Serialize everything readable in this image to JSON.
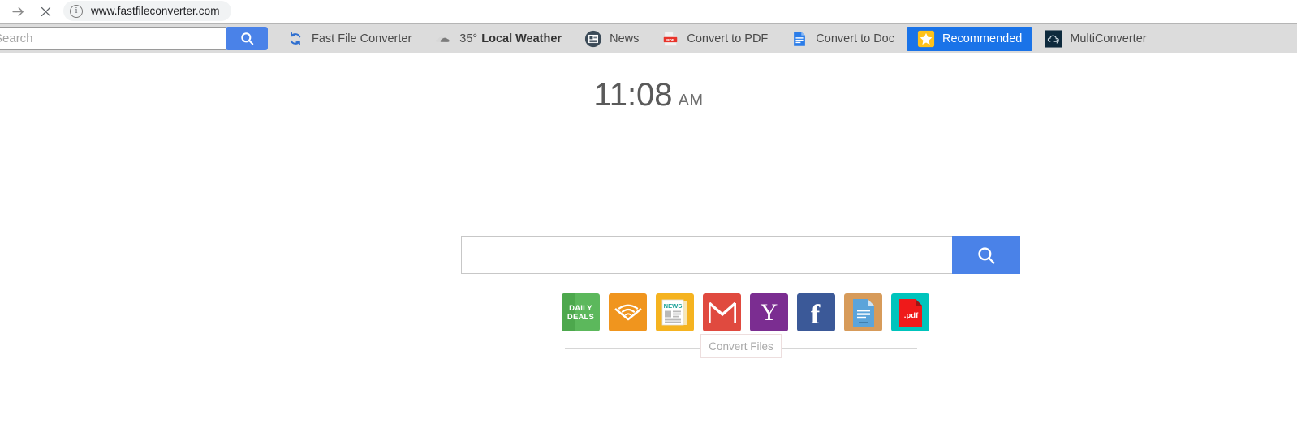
{
  "browser": {
    "forward_icon": "arrow-right-icon",
    "stop_icon": "close-icon",
    "info_icon": "info-icon",
    "info_glyph": "i",
    "url": "www.fastfileconverter.com"
  },
  "toolbar": {
    "search": {
      "placeholder": "Search",
      "value": "",
      "button_icon": "search-icon"
    },
    "items": [
      {
        "icon": "sync-refresh-icon",
        "label": "Fast File Converter",
        "highlight": false
      },
      {
        "icon": "cloud-weather-icon",
        "label": "Local Weather",
        "temp": "35°",
        "highlight": false
      },
      {
        "icon": "newspaper-icon",
        "label": "News",
        "highlight": false
      },
      {
        "icon": "pdf-file-icon",
        "label": "Convert to PDF",
        "highlight": false
      },
      {
        "icon": "doc-file-icon",
        "label": "Convert to Doc",
        "highlight": false
      },
      {
        "icon": "star-icon",
        "label": "Recommended",
        "highlight": true
      },
      {
        "icon": "cloud-upload-icon",
        "label": "MultiConverter",
        "highlight": false
      }
    ]
  },
  "page": {
    "clock": {
      "time": "11:08",
      "meridiem": "AM"
    },
    "search": {
      "placeholder": "",
      "value": "",
      "button_icon": "search-icon"
    },
    "shortcuts": [
      {
        "name": "daily-deals",
        "label": "DAILY\nDEALS",
        "color": "#5cb85c",
        "icon": "text-tile"
      },
      {
        "name": "audible",
        "label": "",
        "color": "#f0951e",
        "icon": "audible-icon"
      },
      {
        "name": "news",
        "label": "NEWS",
        "color": "#f5b320",
        "icon": "news-paper-icon"
      },
      {
        "name": "gmail",
        "label": "",
        "color": "#e04a3f",
        "icon": "envelope-icon"
      },
      {
        "name": "yahoo",
        "label": "Y",
        "color": "#7b2d91",
        "icon": "yahoo-icon"
      },
      {
        "name": "facebook",
        "label": "f",
        "color": "#3b5998",
        "icon": "facebook-icon"
      },
      {
        "name": "convert-to-doc",
        "label": "",
        "color": "#d79b5a",
        "icon": "doc-page-icon"
      },
      {
        "name": "convert-to-pdf",
        "label": ".pdf",
        "color": "#00c4bc",
        "icon": "pdf-page-icon"
      }
    ],
    "tooltip": {
      "label": "Convert Files"
    }
  },
  "colors": {
    "accent_blue": "#4a82e8",
    "highlight_blue": "#1a73e8",
    "toolbar_grey": "#dcdcdc",
    "star_yellow": "#ffc21a"
  }
}
